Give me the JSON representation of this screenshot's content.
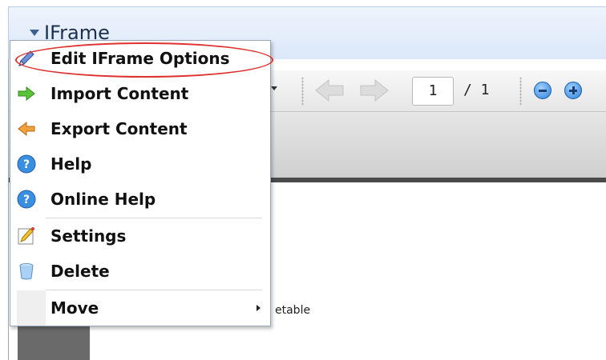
{
  "portlet": {
    "title": "IFrame",
    "collapse_icon": "triangle-down-icon"
  },
  "pdf_toolbar": {
    "page_input_value": "1",
    "page_total": "/ 1",
    "icons": [
      "dropdown-arrow-icon",
      "previous-page-icon",
      "next-page-icon",
      "zoom-out-icon",
      "zoom-in-icon"
    ]
  },
  "background_text": "etable",
  "menu": {
    "highlighted_item": "Edit IFrame Options",
    "highlight_color": "#e03030",
    "items": [
      {
        "label": "Edit IFrame Options",
        "icon": "pencil-icon"
      },
      {
        "label": "Import Content",
        "icon": "green-arrow-right-icon"
      },
      {
        "label": "Export Content",
        "icon": "orange-arrow-left-icon"
      },
      {
        "label": "Help",
        "icon": "help-icon"
      },
      {
        "label": "Online Help",
        "icon": "help-icon"
      },
      {
        "label": "Settings",
        "icon": "settings-pencil-icon"
      },
      {
        "label": "Delete",
        "icon": "trash-icon"
      },
      {
        "label": "Move",
        "icon": "",
        "has_submenu": true
      }
    ]
  },
  "colors": {
    "title_bar": "#dbe7f8",
    "menu_border": "#9aa7b8",
    "highlight": "#e03030"
  }
}
